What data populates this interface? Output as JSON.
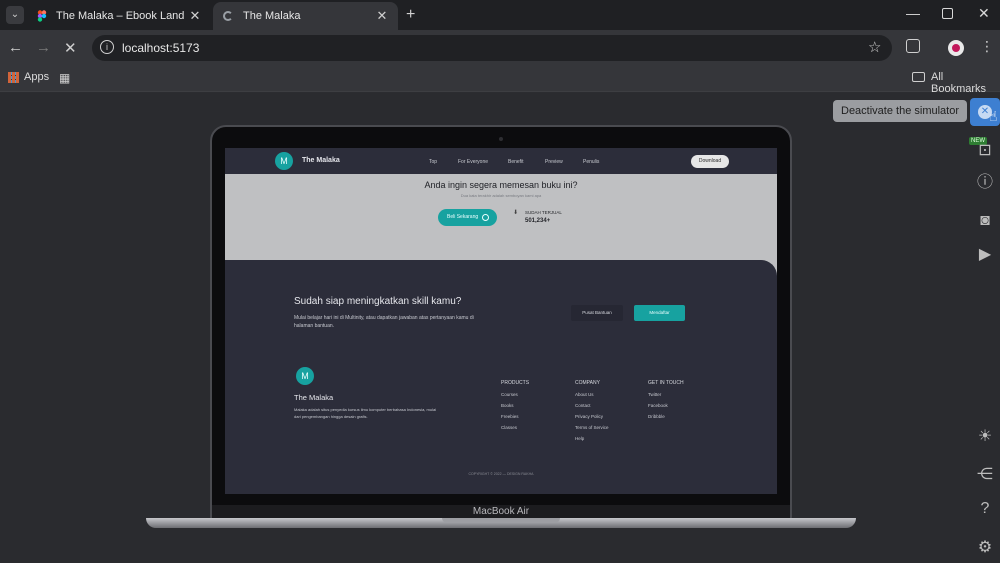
{
  "browser": {
    "tabs": [
      {
        "title": "The Malaka – Ebook Landing Pa",
        "active": false
      },
      {
        "title": "The Malaka",
        "active": true
      }
    ],
    "address": "localhost:5173",
    "bookmarks": {
      "apps": "Apps",
      "all": "All Bookmarks"
    }
  },
  "simulator": {
    "tooltip": "Deactivate the simulator",
    "device_label": "MacBook Air",
    "new_badge": "NEW"
  },
  "site": {
    "logo_letter": "M",
    "brand": "The Malaka",
    "nav": [
      "Top",
      "For Everyone",
      "Benefit",
      "Preview",
      "Penulis"
    ],
    "download": "Download",
    "hero_title": "Anda ingin segera memesan buku ini?",
    "hero_sub": "Dua kata terakhir adalah semboyan kami apa",
    "buy": "Beli Sekarang",
    "sold_label": "SUDAH TERJUAL",
    "sold_value": "501,234+",
    "cta_title": "Sudah siap meningkatkan skill kamu?",
    "cta_sub1": "Mulai belajar hari ini di Multinity, atau dapatkan jawaban atas pertanyaan kamu di",
    "cta_sub2": "halaman bantuan.",
    "help_btn": "Pusat Bantuan",
    "signup_btn": "Mendaftar",
    "footer_brand": "The Malaka",
    "footer_desc1": "Malaka adalah situs penyedia kursus ilmu komputer berbahasa Indonesia, mulai",
    "footer_desc2": "dari pengembangan hingga desain grafis.",
    "columns": [
      {
        "title": "PRODUCTS",
        "items": [
          "Courses",
          "Books",
          "Freebies",
          "Classes"
        ]
      },
      {
        "title": "COMPANY",
        "items": [
          "About Us",
          "Contact",
          "Privacy Policy",
          "Terms of Service",
          "Help"
        ]
      },
      {
        "title": "GET IN TOUCH",
        "items": [
          "Twitter",
          "Facebook",
          "Dribbble"
        ]
      }
    ],
    "copyright": "COPYRIGHT © 2022 — DESIGN RAKHA"
  }
}
